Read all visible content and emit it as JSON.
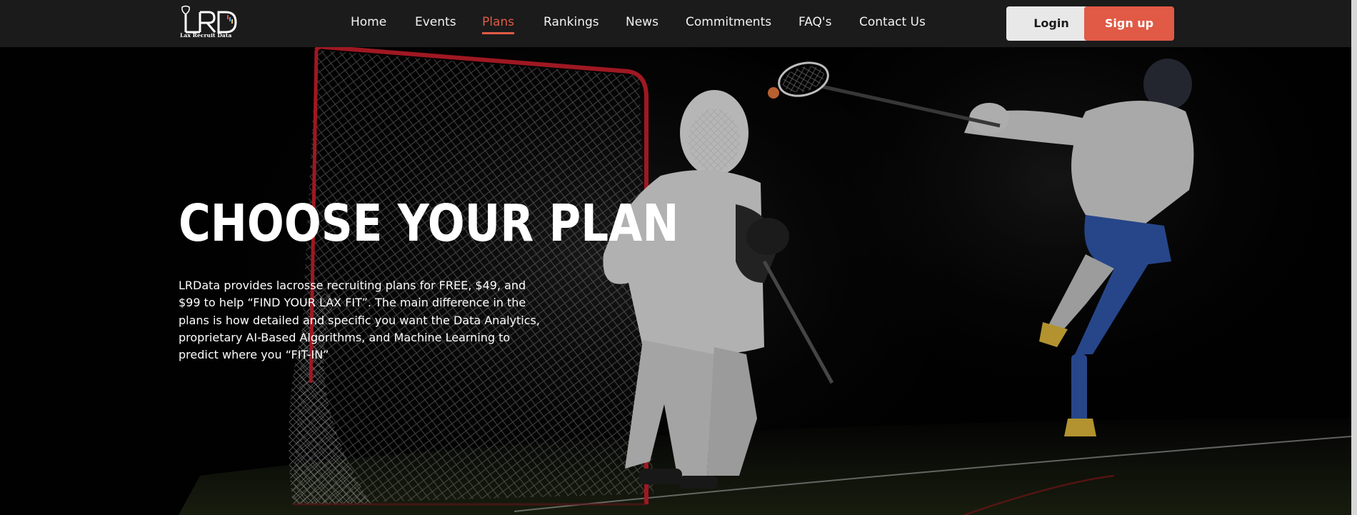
{
  "brand": {
    "logo_text": "LRD",
    "logo_subtitle": "Lax Recruit Data"
  },
  "nav": {
    "items": [
      {
        "label": "Home",
        "active": false
      },
      {
        "label": "Events",
        "active": false
      },
      {
        "label": "Plans",
        "active": true
      },
      {
        "label": "Rankings",
        "active": false
      },
      {
        "label": "News",
        "active": false
      },
      {
        "label": "Commitments",
        "active": false
      },
      {
        "label": "FAQ's",
        "active": false
      },
      {
        "label": "Contact Us",
        "active": false
      }
    ],
    "login_label": "Login",
    "signup_label": "Sign up"
  },
  "hero": {
    "title": "CHOOSE YOUR PLAN",
    "description": "LRData provides lacrosse recruiting plans for FREE, $49, and $99 to help “FIND YOUR LAX FIT”. The main difference in the plans is how detailed and specific you want the Data Analytics, proprietary AI-Based Algorithms, and Machine Learning to predict where you “FIT-IN”",
    "background_image": "lacrosse-goalie-and-shooter-at-night"
  },
  "colors": {
    "accent": "#e05a45",
    "nav_bg": "#1b1b1b",
    "login_bg": "#e8e8e8"
  }
}
